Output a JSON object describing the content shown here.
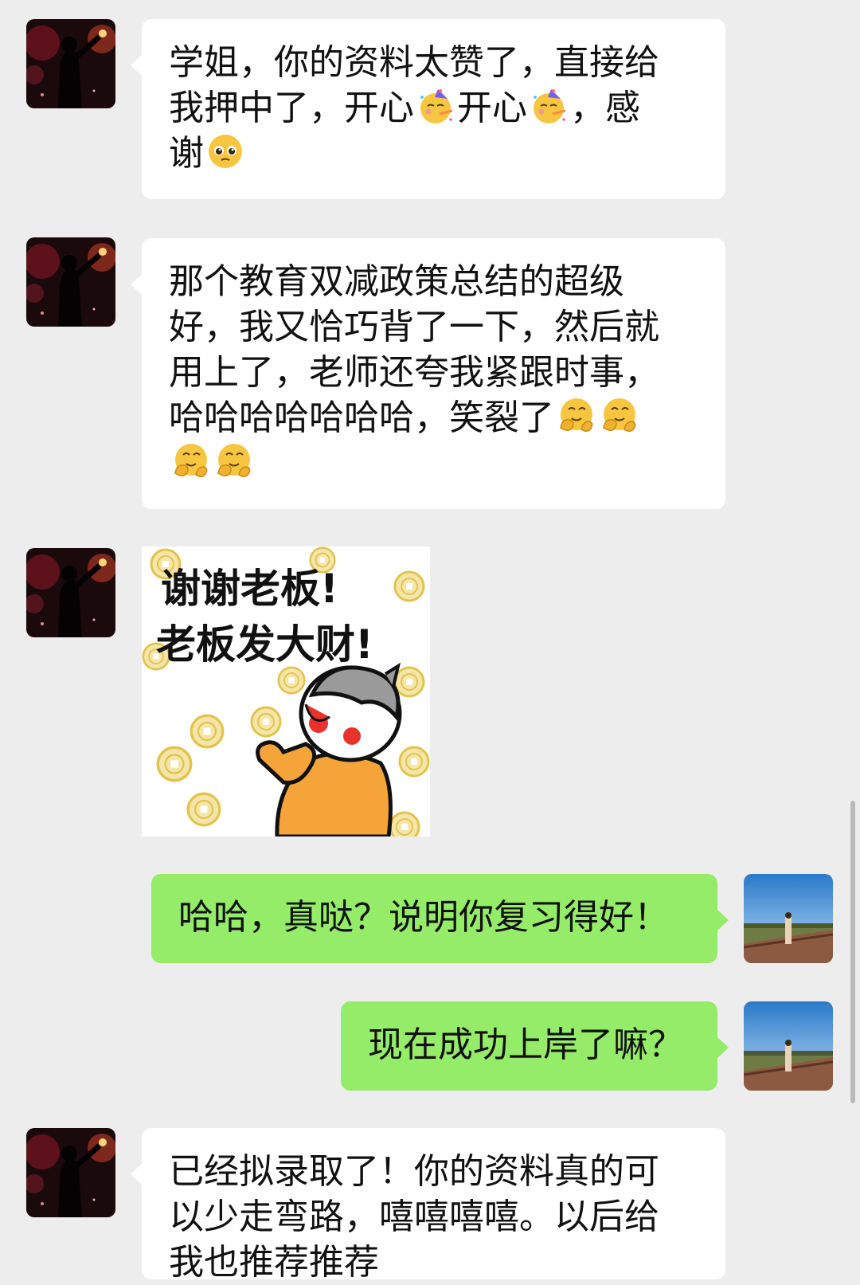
{
  "messages": [
    {
      "sender": "contact",
      "type": "text",
      "segments": [
        "学姐，你的资料太赞了，直接给\n我押中了，开心",
        "[partying-face]",
        "开心",
        "[partying-face]",
        "，感\n谢",
        "[pleading-face]"
      ]
    },
    {
      "sender": "contact",
      "type": "text",
      "segments": [
        "那个教育双减政策总结的超级\n好，我又恰巧背了一下，然后就\n用上了，老师还夸我紧跟时事，\n哈哈哈哈哈哈哈，笑裂了",
        "[hugging-face]",
        "[hugging-face]",
        "\n",
        "[hugging-face]",
        "[hugging-face]"
      ]
    },
    {
      "sender": "contact",
      "type": "sticker",
      "lines": [
        "谢谢老板!",
        "老板发大财!"
      ]
    },
    {
      "sender": "me",
      "type": "text",
      "text": "哈哈，真哒？说明你复习得好！"
    },
    {
      "sender": "me",
      "type": "text",
      "text": "现在成功上岸了嘛？"
    },
    {
      "sender": "contact",
      "type": "text",
      "segments": [
        "已经拟录取了！你的资料真的可\n以少走弯路，嘻嘻嘻嘻。以后给\n我也推荐推荐"
      ]
    }
  ],
  "emoji_icons": [
    "partying-face",
    "pleading-face",
    "hugging-face"
  ],
  "colors": {
    "background": "#ededed",
    "incoming_bubble": "#ffffff",
    "outgoing_bubble": "#95ec69"
  }
}
